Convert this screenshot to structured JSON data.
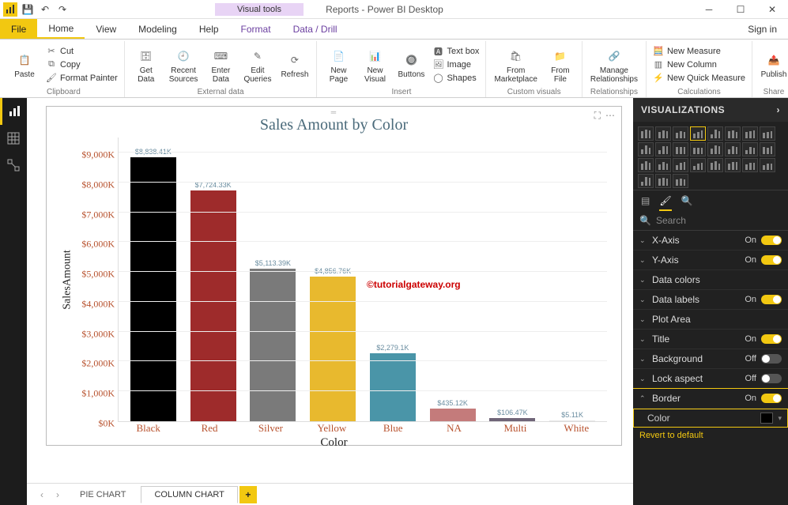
{
  "title_chip": "Visual tools",
  "app_title": "Reports - Power BI Desktop",
  "signin": "Sign in",
  "tabs": {
    "file": "File",
    "home": "Home",
    "view": "View",
    "modeling": "Modeling",
    "help": "Help",
    "format": "Format",
    "datadrill": "Data / Drill"
  },
  "ribbon": {
    "clipboard": {
      "paste": "Paste",
      "cut": "Cut",
      "copy": "Copy",
      "fp": "Format Painter",
      "group": "Clipboard"
    },
    "external": {
      "getdata": "Get\nData",
      "recent": "Recent\nSources",
      "enter": "Enter\nData",
      "edit": "Edit\nQueries",
      "refresh": "Refresh",
      "group": "External data"
    },
    "insert": {
      "newpage": "New\nPage",
      "newvisual": "New\nVisual",
      "buttons": "Buttons",
      "textbox": "Text box",
      "image": "Image",
      "shapes": "Shapes",
      "group": "Insert"
    },
    "custom": {
      "market": "From\nMarketplace",
      "file": "From\nFile",
      "group": "Custom visuals"
    },
    "rel": {
      "manage": "Manage\nRelationships",
      "group": "Relationships"
    },
    "calc": {
      "newmeasure": "New Measure",
      "newcolumn": "New Column",
      "newquick": "New Quick Measure",
      "group": "Calculations"
    },
    "share": {
      "publish": "Publish",
      "group": "Share"
    }
  },
  "chart_data": {
    "type": "bar",
    "title": "Sales Amount by Color",
    "xlabel": "Color",
    "ylabel": "SalesAmount",
    "ylim": [
      0,
      9000
    ],
    "ytick_labels": [
      "$0K",
      "$1,000K",
      "$2,000K",
      "$3,000K",
      "$4,000K",
      "$5,000K",
      "$6,000K",
      "$7,000K",
      "$8,000K",
      "$9,000K"
    ],
    "categories": [
      "Black",
      "Red",
      "Silver",
      "Yellow",
      "Blue",
      "NA",
      "Multi",
      "White"
    ],
    "values": [
      8838.41,
      7724.33,
      5113.39,
      4856.76,
      2279.1,
      435.12,
      106.47,
      5.11
    ],
    "data_labels": [
      "$8,838.41K",
      "$7,724.33K",
      "$5,113.39K",
      "$4,856.76K",
      "$2,279.1K",
      "$435.12K",
      "$106.47K",
      "$5.11K"
    ],
    "colors": [
      "#000000",
      "#9e2b2b",
      "#7a7a7a",
      "#e8b92e",
      "#4a95a8",
      "#c47b7b",
      "#6f6578",
      "#e6e6e6"
    ]
  },
  "sheets": {
    "pie": "PIE CHART",
    "column": "COLUMN CHART"
  },
  "viz": {
    "header": "VISUALIZATIONS",
    "search_placeholder": "Search",
    "items": {
      "xaxis": {
        "name": "X-Axis",
        "state": "On",
        "on": true
      },
      "yaxis": {
        "name": "Y-Axis",
        "state": "On",
        "on": true
      },
      "datacolors": {
        "name": "Data colors"
      },
      "datalabels": {
        "name": "Data labels",
        "state": "On",
        "on": true
      },
      "plotarea": {
        "name": "Plot Area"
      },
      "title": {
        "name": "Title",
        "state": "On",
        "on": true
      },
      "background": {
        "name": "Background",
        "state": "Off",
        "on": false
      },
      "lock": {
        "name": "Lock aspect",
        "state": "Off",
        "on": false
      },
      "border": {
        "name": "Border",
        "state": "On",
        "on": true
      }
    },
    "color_label": "Color",
    "revert": "Revert to default"
  },
  "watermark": "©tutorialgateway.org"
}
